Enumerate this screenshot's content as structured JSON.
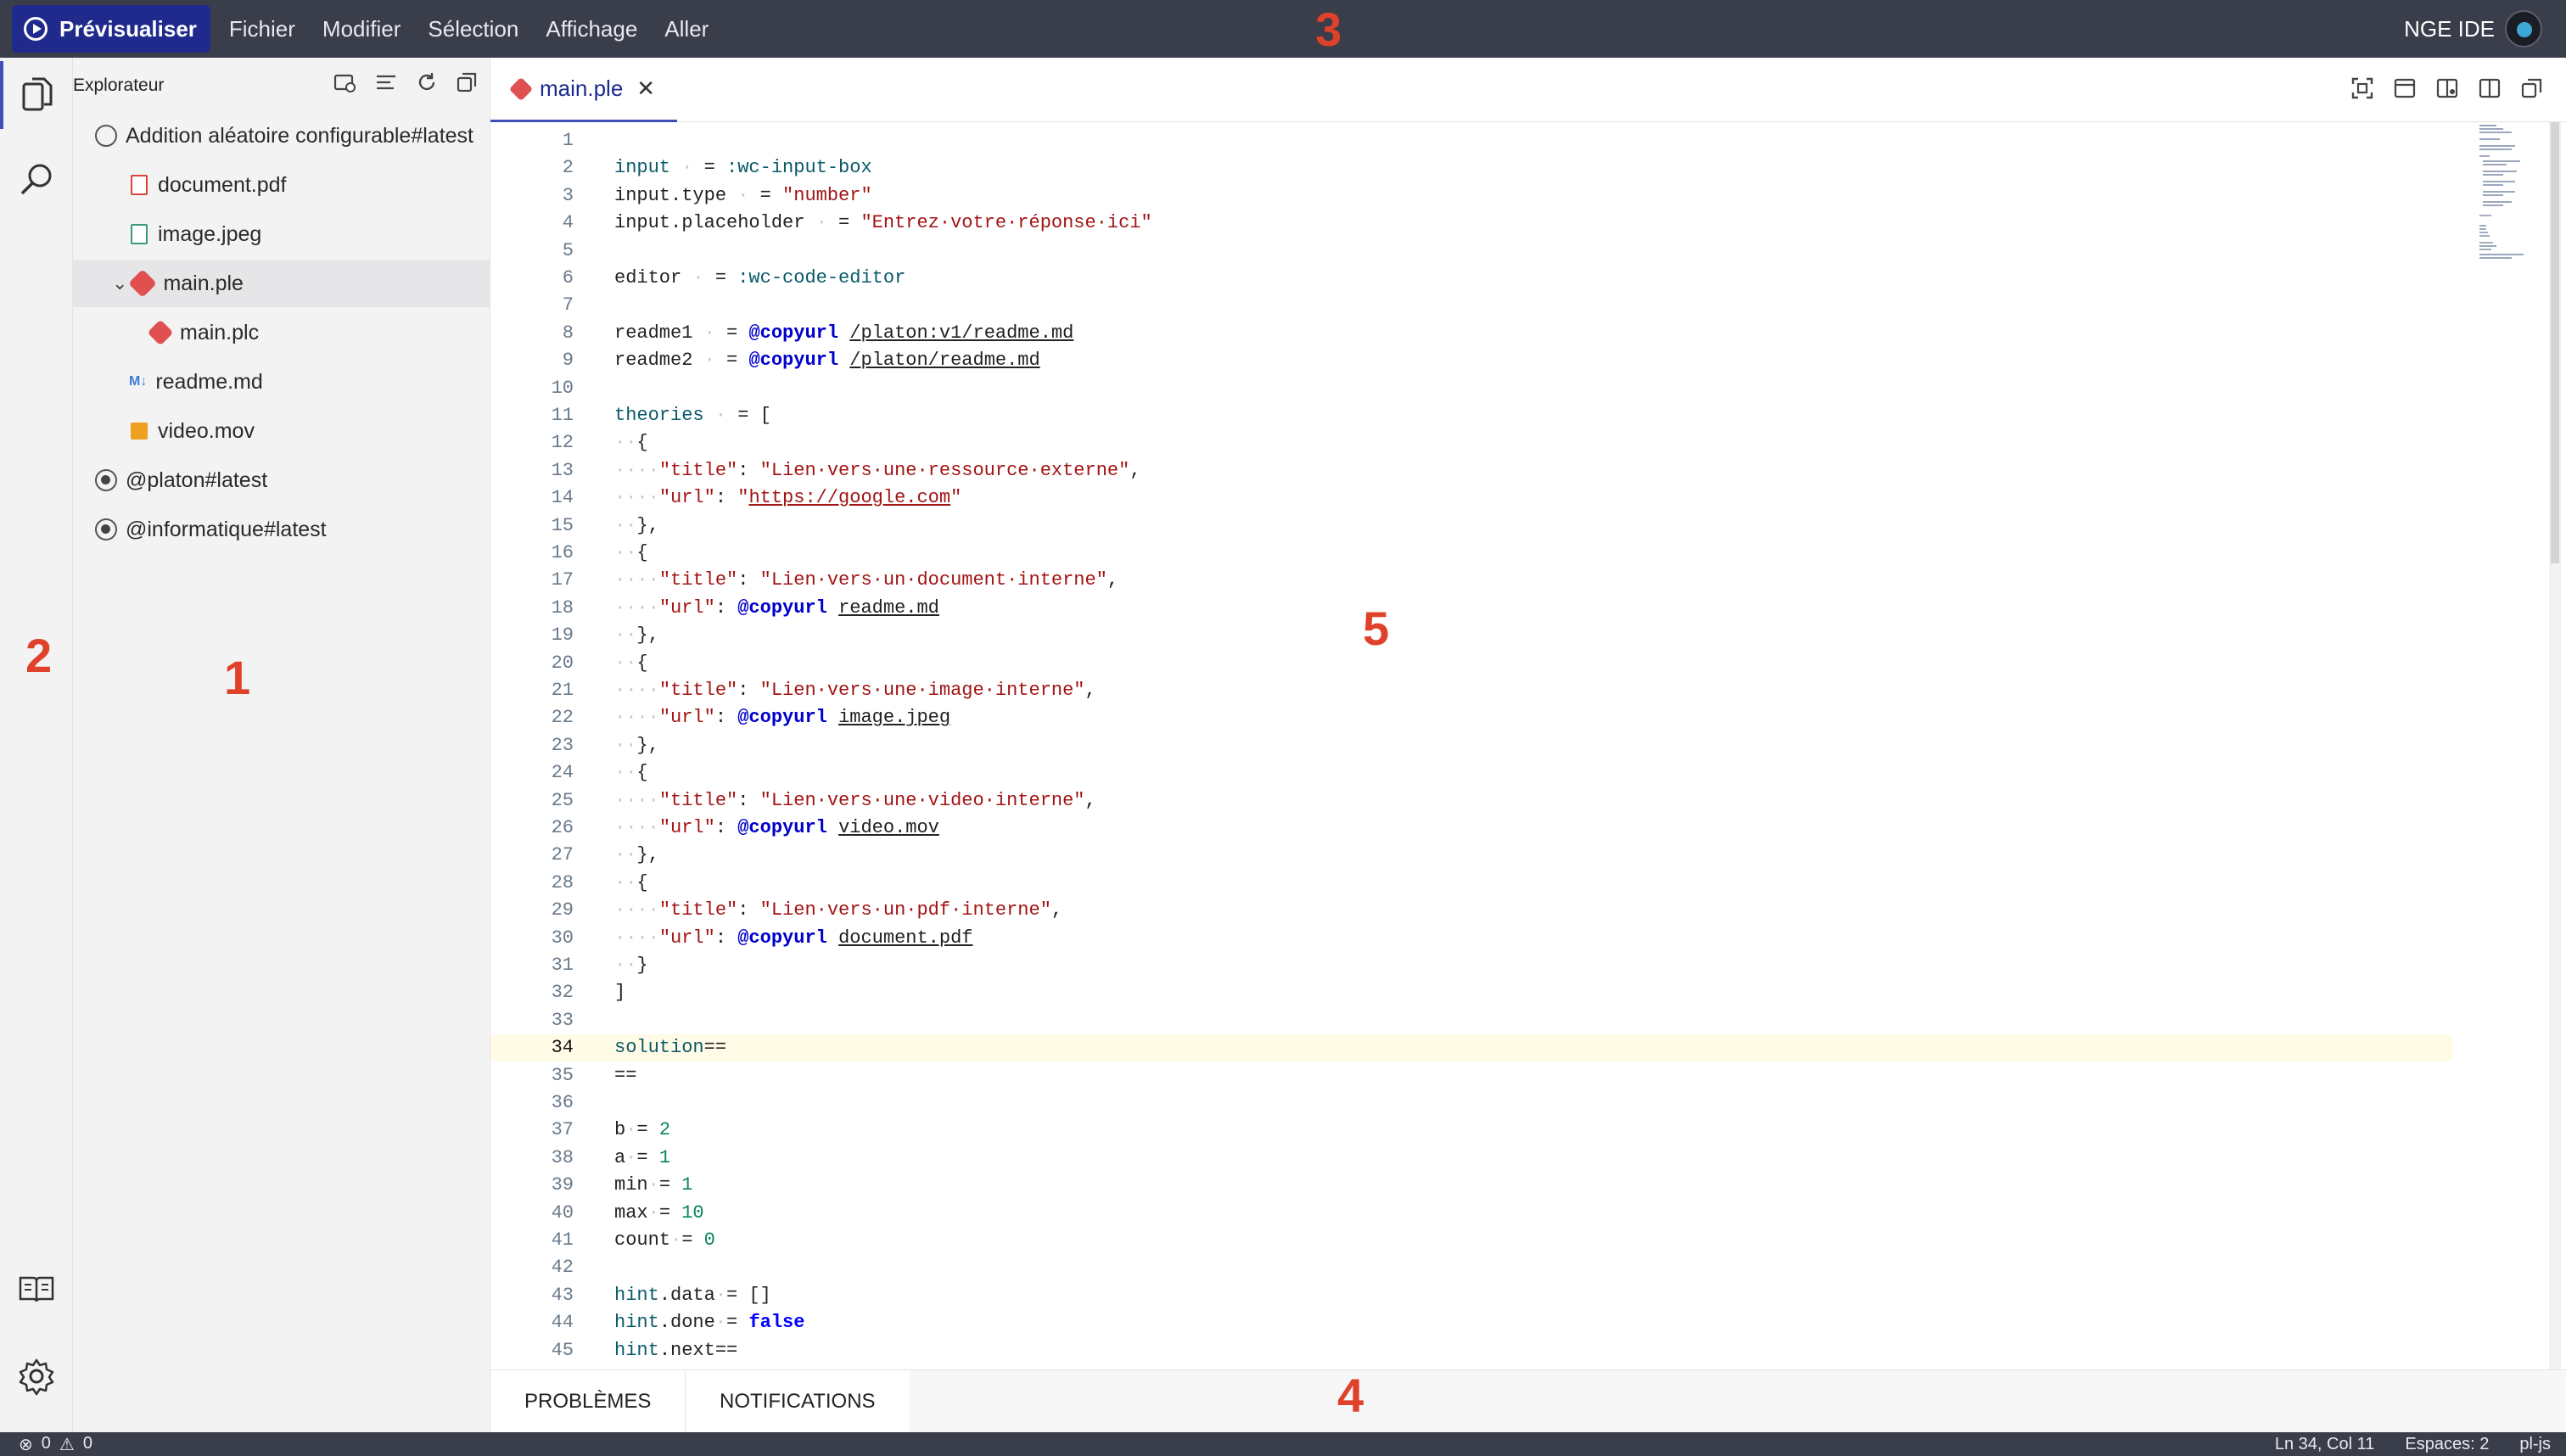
{
  "topbar": {
    "preview_label": "Prévisualiser",
    "menu": [
      "Fichier",
      "Modifier",
      "Sélection",
      "Affichage",
      "Aller"
    ],
    "brand": "NGE IDE"
  },
  "markers": [
    "1",
    "2",
    "3",
    "4",
    "5"
  ],
  "explorer": {
    "title": "Explorateur",
    "items": [
      {
        "label": "Addition aléatoire configurable#latest",
        "type": "root-open"
      },
      {
        "label": "document.pdf",
        "type": "pdf"
      },
      {
        "label": "image.jpeg",
        "type": "image"
      },
      {
        "label": "main.ple",
        "type": "ple",
        "expanded": true
      },
      {
        "label": "main.plc",
        "type": "ple"
      },
      {
        "label": "readme.md",
        "type": "md"
      },
      {
        "label": "video.mov",
        "type": "video"
      },
      {
        "label": "@platon#latest",
        "type": "root"
      },
      {
        "label": "@informatique#latest",
        "type": "root"
      }
    ]
  },
  "editor": {
    "tab": "main.ple",
    "current_line": 34,
    "lines": [
      [],
      [
        [
          "k",
          "input"
        ],
        [
          "dot",
          " · "
        ],
        [
          "p",
          "= "
        ],
        [
          "k",
          ":wc-input-box"
        ]
      ],
      [
        [
          "p",
          "input.type"
        ],
        [
          "dot",
          " · "
        ],
        [
          "p",
          "= "
        ],
        [
          "s",
          "\"number\""
        ]
      ],
      [
        [
          "p",
          "input.placeholder"
        ],
        [
          "dot",
          " · "
        ],
        [
          "p",
          "= "
        ],
        [
          "s",
          "\"Entrez·votre·réponse·ici\""
        ]
      ],
      [],
      [
        [
          "p",
          "editor"
        ],
        [
          "dot",
          " · "
        ],
        [
          "p",
          "= "
        ],
        [
          "k",
          ":wc-code-editor"
        ]
      ],
      [],
      [
        [
          "p",
          "readme1"
        ],
        [
          "dot",
          " · "
        ],
        [
          "p",
          "= "
        ],
        [
          "d",
          "@copyurl"
        ],
        [
          "p",
          " "
        ],
        [
          "u",
          "/platon:v1/readme.md"
        ]
      ],
      [
        [
          "p",
          "readme2"
        ],
        [
          "dot",
          " · "
        ],
        [
          "p",
          "= "
        ],
        [
          "d",
          "@copyurl"
        ],
        [
          "p",
          " "
        ],
        [
          "u",
          "/platon/readme.md"
        ]
      ],
      [],
      [
        [
          "k",
          "theories"
        ],
        [
          "dot",
          " · "
        ],
        [
          "p",
          "= ["
        ]
      ],
      [
        [
          "dot",
          "··"
        ],
        [
          "p",
          "{"
        ]
      ],
      [
        [
          "dot",
          "····"
        ],
        [
          "s",
          "\"title\""
        ],
        [
          "p",
          ": "
        ],
        [
          "s",
          "\"Lien·vers·une·ressource·externe\""
        ],
        [
          "p",
          ","
        ]
      ],
      [
        [
          "dot",
          "····"
        ],
        [
          "s",
          "\"url\""
        ],
        [
          "p",
          ": "
        ],
        [
          "s",
          "\"https://google.com\""
        ]
      ],
      [
        [
          "dot",
          "··"
        ],
        [
          "p",
          "},"
        ]
      ],
      [
        [
          "dot",
          "··"
        ],
        [
          "p",
          "{"
        ]
      ],
      [
        [
          "dot",
          "····"
        ],
        [
          "s",
          "\"title\""
        ],
        [
          "p",
          ": "
        ],
        [
          "s",
          "\"Lien·vers·un·document·interne\""
        ],
        [
          "p",
          ","
        ]
      ],
      [
        [
          "dot",
          "····"
        ],
        [
          "s",
          "\"url\""
        ],
        [
          "p",
          ": "
        ],
        [
          "d",
          "@copyurl"
        ],
        [
          "p",
          " "
        ],
        [
          "u",
          "readme.md"
        ]
      ],
      [
        [
          "dot",
          "··"
        ],
        [
          "p",
          "},"
        ]
      ],
      [
        [
          "dot",
          "··"
        ],
        [
          "p",
          "{"
        ]
      ],
      [
        [
          "dot",
          "····"
        ],
        [
          "s",
          "\"title\""
        ],
        [
          "p",
          ": "
        ],
        [
          "s",
          "\"Lien·vers·une·image·interne\""
        ],
        [
          "p",
          ","
        ]
      ],
      [
        [
          "dot",
          "····"
        ],
        [
          "s",
          "\"url\""
        ],
        [
          "p",
          ": "
        ],
        [
          "d",
          "@copyurl"
        ],
        [
          "p",
          " "
        ],
        [
          "u",
          "image.jpeg"
        ]
      ],
      [
        [
          "dot",
          "··"
        ],
        [
          "p",
          "},"
        ]
      ],
      [
        [
          "dot",
          "··"
        ],
        [
          "p",
          "{"
        ]
      ],
      [
        [
          "dot",
          "····"
        ],
        [
          "s",
          "\"title\""
        ],
        [
          "p",
          ": "
        ],
        [
          "s",
          "\"Lien·vers·une·video·interne\""
        ],
        [
          "p",
          ","
        ]
      ],
      [
        [
          "dot",
          "····"
        ],
        [
          "s",
          "\"url\""
        ],
        [
          "p",
          ": "
        ],
        [
          "d",
          "@copyurl"
        ],
        [
          "p",
          " "
        ],
        [
          "u",
          "video.mov"
        ]
      ],
      [
        [
          "dot",
          "··"
        ],
        [
          "p",
          "},"
        ]
      ],
      [
        [
          "dot",
          "··"
        ],
        [
          "p",
          "{"
        ]
      ],
      [
        [
          "dot",
          "····"
        ],
        [
          "s",
          "\"title\""
        ],
        [
          "p",
          ": "
        ],
        [
          "s",
          "\"Lien·vers·un·pdf·interne\""
        ],
        [
          "p",
          ","
        ]
      ],
      [
        [
          "dot",
          "····"
        ],
        [
          "s",
          "\"url\""
        ],
        [
          "p",
          ": "
        ],
        [
          "d",
          "@copyurl"
        ],
        [
          "p",
          " "
        ],
        [
          "u",
          "document.pdf"
        ]
      ],
      [
        [
          "dot",
          "··"
        ],
        [
          "p",
          "}"
        ]
      ],
      [
        [
          "p",
          "]"
        ]
      ],
      [],
      [
        [
          "k",
          "solution"
        ],
        [
          "p",
          "=="
        ]
      ],
      [
        [
          "p",
          "=="
        ]
      ],
      [],
      [
        [
          "p",
          "b"
        ],
        [
          "dot",
          "·"
        ],
        [
          "p",
          "= "
        ],
        [
          "n",
          "2"
        ]
      ],
      [
        [
          "p",
          "a"
        ],
        [
          "dot",
          "·"
        ],
        [
          "p",
          "= "
        ],
        [
          "n",
          "1"
        ]
      ],
      [
        [
          "p",
          "min"
        ],
        [
          "dot",
          "·"
        ],
        [
          "p",
          "= "
        ],
        [
          "n",
          "1"
        ]
      ],
      [
        [
          "p",
          "max"
        ],
        [
          "dot",
          "·"
        ],
        [
          "p",
          "= "
        ],
        [
          "n",
          "10"
        ]
      ],
      [
        [
          "p",
          "count"
        ],
        [
          "dot",
          "·"
        ],
        [
          "p",
          "= "
        ],
        [
          "n",
          "0"
        ]
      ],
      [],
      [
        [
          "k",
          "hint"
        ],
        [
          "p",
          ".data"
        ],
        [
          "dot",
          "·"
        ],
        [
          "p",
          "= []"
        ]
      ],
      [
        [
          "k",
          "hint"
        ],
        [
          "p",
          ".done"
        ],
        [
          "dot",
          "·"
        ],
        [
          "p",
          "= "
        ],
        [
          "b",
          "false"
        ]
      ],
      [
        [
          "k",
          "hint"
        ],
        [
          "p",
          ".next=="
        ]
      ]
    ]
  },
  "panel": {
    "tabs": [
      "PROBLÈMES",
      "NOTIFICATIONS"
    ]
  },
  "status": {
    "errors": "0",
    "warnings": "0",
    "position": "Ln 34, Col 11",
    "spaces": "Espaces: 2",
    "language": "pl-js"
  },
  "colors": {
    "topbar_bg": "#3a3d4a",
    "preview_bg": "#1f2a8c",
    "marker": "#e0412b"
  }
}
